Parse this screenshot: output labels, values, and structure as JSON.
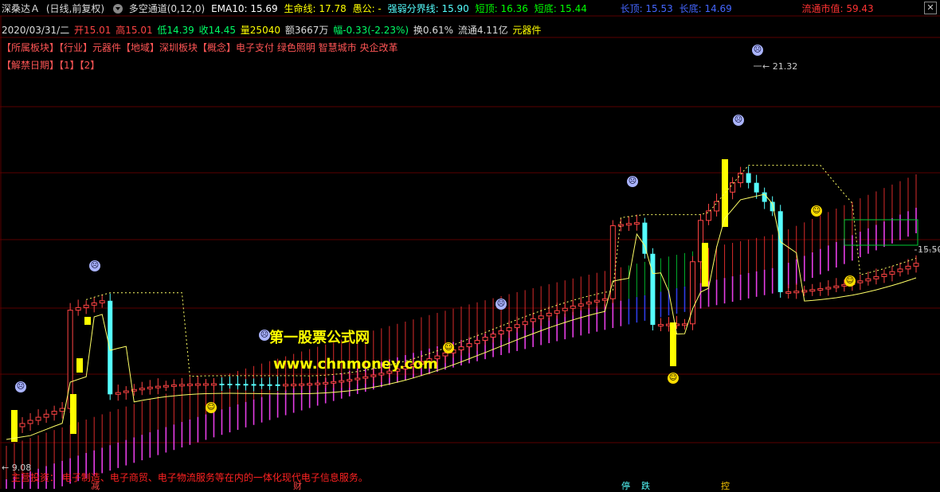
{
  "header": {
    "stock_name": "深桑达Ａ",
    "period": "(日线,前复权)",
    "indicator_name": "多空通道(0,12,0)",
    "ema10": "EMA10: 15.69",
    "lifeline": "生命线: 17.78",
    "fool": "愚公: -",
    "strong_weak": "强弱分界线: 15.90",
    "short_top": "短顶: 16.36",
    "short_bottom": "短底: 15.44",
    "long_top": "长顶: 15.53",
    "long_bottom": "长底: 14.69",
    "float_value": "流通市值: 59.43"
  },
  "info": {
    "date": "2020/03/31/二",
    "open": "开15.01",
    "high": "高15.01",
    "low": "低14.39",
    "close": "收14.45",
    "volume": "量25040",
    "amount": "额3667万",
    "change": "幅-0.33(-2.23%)",
    "turnover": "换0.61%",
    "float_shares": "流通4.11亿",
    "industry": "元器件"
  },
  "sector": {
    "text": "【所属板块】【行业】元器件【地域】深圳板块【概念】电子支付 绿色照明 智慧城市 央企改革"
  },
  "unlock": {
    "text": "【解禁日期】【1】【2】"
  },
  "labels": {
    "high_price": "21.32",
    "low_price": "9.08",
    "current_price": "15.50"
  },
  "watermark": {
    "line1": "第一股票公式网",
    "line2": "www.chnmoney.com"
  },
  "footer": {
    "business": "主营投资：   电子制造、电子商贸、电子物流服务等在内的一体化现代电子信息服务。"
  },
  "axis_marks": [
    "减",
    "财",
    "停",
    "跌",
    "控"
  ],
  "colors": {
    "up": "#ff4444",
    "down": "#55ffff",
    "yellow": "#ffff00",
    "magenta": "#ff44ff",
    "green": "#00cc33"
  }
}
